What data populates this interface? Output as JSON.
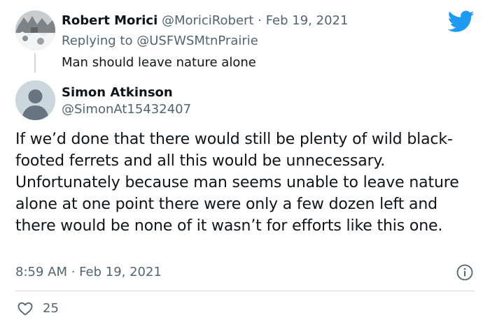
{
  "parent_tweet": {
    "author_name": "Robert Morici",
    "author_handle": "@MoriciRobert",
    "separator": "·",
    "date": "Feb 19, 2021",
    "replying_prefix": "Replying to",
    "replying_to": "@USFWSMtnPrairie",
    "text": "Man should leave nature alone"
  },
  "reply_tweet": {
    "author_name": "Simon Atkinson",
    "author_handle": "@SimonAt15432407",
    "text": "If we’d done that there would still be plenty of wild black-footed ferrets and all this would be unnecessary. Unfortunately because man seems unable to leave nature alone at one point there were only a few dozen left and there would be none of it wasn’t for efforts like this one.",
    "timestamp": "8:59 AM · Feb 19, 2021",
    "like_count": "25"
  },
  "icons": {
    "brand": "twitter-bird-icon",
    "info": "info-icon",
    "like": "heart-icon"
  },
  "colors": {
    "brand_blue": "#1d9bf0",
    "muted_text": "#536471",
    "divider": "#cfd9de",
    "text": "#0f1419"
  }
}
